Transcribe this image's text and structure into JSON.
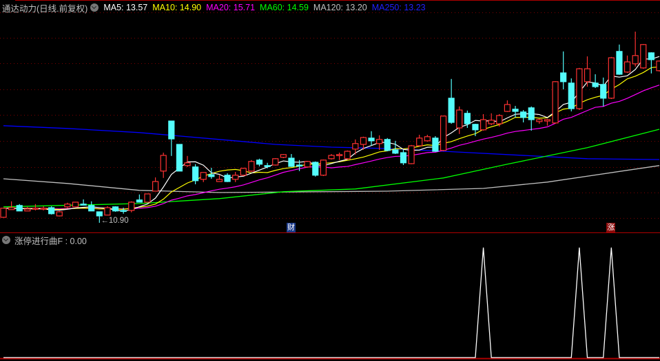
{
  "header": {
    "title": "通达动力(日线.前复权)",
    "ma5": "MA5: 13.57",
    "ma10": "MA10: 14.90",
    "ma20": "MA20: 15.71",
    "ma60": "MA60: 14.59",
    "ma120": "MA120: 13.20",
    "ma250": "MA250: 13.23"
  },
  "colors": {
    "up": "#ff3232",
    "down": "#54fcfc",
    "ma5": "#ffffff",
    "ma10": "#ffff00",
    "ma20": "#ff00ff",
    "ma60": "#00ff00",
    "ma120": "#c0c0c0",
    "ma250": "#0000ff",
    "grid": "#800000",
    "separator": "#b00000"
  },
  "low_label": "←10.90",
  "markers": [
    {
      "text": "财",
      "candle": 36,
      "bg": "#1a3a8a"
    },
    {
      "text": "涨",
      "candle": 76,
      "bg": "#8a0a0a"
    }
  ],
  "indicator": {
    "label": "涨停进行曲F : 0.00",
    "spike_candles": [
      60,
      72,
      76
    ]
  },
  "chart_data": {
    "type": "candlestick",
    "price_range": [
      10.0,
      19.0
    ],
    "candles": [
      [
        11.1,
        11.43,
        11.43,
        11.08
      ],
      [
        11.38,
        11.45,
        11.68,
        11.38
      ],
      [
        11.53,
        11.33,
        11.58,
        11.33
      ],
      [
        11.33,
        11.4,
        11.48,
        11.33
      ],
      [
        11.4,
        11.43,
        11.58,
        11.35
      ],
      [
        11.4,
        11.43,
        11.5,
        11.35
      ],
      [
        11.45,
        11.23,
        11.5,
        11.2
      ],
      [
        11.15,
        11.3,
        11.33,
        11.13
      ],
      [
        11.48,
        11.58,
        11.63,
        11.43
      ],
      [
        11.48,
        11.65,
        11.65,
        11.48
      ],
      [
        11.58,
        11.55,
        11.75,
        11.53
      ],
      [
        11.53,
        11.33,
        11.68,
        11.33
      ],
      [
        11.3,
        11.15,
        11.3,
        10.9
      ],
      [
        11.18,
        11.45,
        11.5,
        11.18
      ],
      [
        11.48,
        11.33,
        11.5,
        11.3
      ],
      [
        11.35,
        11.33,
        11.45,
        11.23
      ],
      [
        11.35,
        11.65,
        11.68,
        11.28
      ],
      [
        11.73,
        11.65,
        11.93,
        11.65
      ],
      [
        11.65,
        11.95,
        11.95,
        11.65
      ],
      [
        12.05,
        12.4,
        12.55,
        12.05
      ],
      [
        12.78,
        13.35,
        13.45,
        12.53
      ],
      [
        14.6,
        13.95,
        14.6,
        13.33
      ],
      [
        13.75,
        12.78,
        13.75,
        12.78
      ],
      [
        12.98,
        13.08,
        13.33,
        12.93
      ],
      [
        12.93,
        12.43,
        13.03,
        12.3
      ],
      [
        12.48,
        12.73,
        12.73,
        12.38
      ],
      [
        12.65,
        12.58,
        12.9,
        12.5
      ],
      [
        12.4,
        12.48,
        12.63,
        12.4
      ],
      [
        12.63,
        12.4,
        12.7,
        12.38
      ],
      [
        12.48,
        12.63,
        12.75,
        12.38
      ],
      [
        12.63,
        12.88,
        12.9,
        12.6
      ],
      [
        12.78,
        13.13,
        13.18,
        12.75
      ],
      [
        13.18,
        13.03,
        13.23,
        12.95
      ],
      [
        12.98,
        12.97,
        13.08,
        12.88
      ],
      [
        13.0,
        13.23,
        13.25,
        12.98
      ],
      [
        13.28,
        13.38,
        13.4,
        13.25
      ],
      [
        13.25,
        12.95,
        13.4,
        12.93
      ],
      [
        13.0,
        12.98,
        13.18,
        12.78
      ],
      [
        12.93,
        13.13,
        13.15,
        12.9
      ],
      [
        13.1,
        12.63,
        13.13,
        12.58
      ],
      [
        12.63,
        13.18,
        13.2,
        12.6
      ],
      [
        13.23,
        13.35,
        13.4,
        13.2
      ],
      [
        13.35,
        13.38,
        13.45,
        13.18
      ],
      [
        13.23,
        13.5,
        13.53,
        13.2
      ],
      [
        13.58,
        13.78,
        13.93,
        13.38
      ],
      [
        13.75,
        14.0,
        14.03,
        13.55
      ],
      [
        13.98,
        13.88,
        14.23,
        13.7
      ],
      [
        13.78,
        13.93,
        14.08,
        13.55
      ],
      [
        13.93,
        13.53,
        13.98,
        13.5
      ],
      [
        13.55,
        13.43,
        13.88,
        13.4
      ],
      [
        13.45,
        13.08,
        13.55,
        13.0
      ],
      [
        13.05,
        13.7,
        13.73,
        13.03
      ],
      [
        13.7,
        13.98,
        14.1,
        13.68
      ],
      [
        13.88,
        14.03,
        14.1,
        13.85
      ],
      [
        13.98,
        13.5,
        14.05,
        13.48
      ],
      [
        13.53,
        14.78,
        14.8,
        13.5
      ],
      [
        15.43,
        14.55,
        16.13,
        14.5
      ],
      [
        14.35,
        15.0,
        15.13,
        14.13
      ],
      [
        14.88,
        14.5,
        14.98,
        14.35
      ],
      [
        14.48,
        14.28,
        14.5,
        14.05
      ],
      [
        14.28,
        14.65,
        14.85,
        14.25
      ],
      [
        14.5,
        14.63,
        14.88,
        14.45
      ],
      [
        14.5,
        14.8,
        14.85,
        14.4
      ],
      [
        14.95,
        15.2,
        15.35,
        14.93
      ],
      [
        15.03,
        14.95,
        15.15,
        14.73
      ],
      [
        14.93,
        14.73,
        15.0,
        14.55
      ],
      [
        15.08,
        14.65,
        15.13,
        14.25
      ],
      [
        14.58,
        14.65,
        14.68,
        14.5
      ],
      [
        14.6,
        14.65,
        14.68,
        14.43
      ],
      [
        14.53,
        16.03,
        16.05,
        14.5
      ],
      [
        16.35,
        16.03,
        17.13,
        15.75
      ],
      [
        15.98,
        15.05,
        16.15,
        14.95
      ],
      [
        15.05,
        16.5,
        16.53,
        15.0
      ],
      [
        16.03,
        16.5,
        16.95,
        15.85
      ],
      [
        15.98,
        15.85,
        16.3,
        15.8
      ],
      [
        15.93,
        15.43,
        16.18,
        15.13
      ],
      [
        15.43,
        16.9,
        16.93,
        15.4
      ],
      [
        17.13,
        16.3,
        17.38,
        16.28
      ],
      [
        16.38,
        16.75,
        16.98,
        16.35
      ],
      [
        16.68,
        16.98,
        17.85,
        16.58
      ],
      [
        16.53,
        17.38,
        17.4,
        16.5
      ],
      [
        17.08,
        16.83,
        17.1,
        16.33
      ],
      [
        16.43,
        16.78,
        16.8,
        16.4
      ]
    ],
    "ma60": [
      [
        0,
        11.48
      ],
      [
        17,
        11.6
      ],
      [
        27,
        11.78
      ],
      [
        35,
        12.03
      ],
      [
        44,
        12.13
      ],
      [
        55,
        12.53
      ],
      [
        63,
        13.03
      ],
      [
        73,
        13.63
      ],
      [
        82,
        14.3
      ]
    ],
    "ma120": [
      [
        0,
        12.5
      ],
      [
        8,
        12.33
      ],
      [
        17,
        12.08
      ],
      [
        27,
        12.0
      ],
      [
        48,
        12.05
      ],
      [
        60,
        12.15
      ],
      [
        68,
        12.38
      ],
      [
        82,
        12.98
      ]
    ],
    "ma250": [
      [
        0,
        14.43
      ],
      [
        8,
        14.33
      ],
      [
        17,
        14.18
      ],
      [
        27,
        13.93
      ],
      [
        34,
        13.75
      ],
      [
        41,
        13.65
      ],
      [
        48,
        13.6
      ],
      [
        55,
        13.5
      ],
      [
        73,
        13.23
      ],
      [
        82,
        13.2
      ]
    ]
  }
}
